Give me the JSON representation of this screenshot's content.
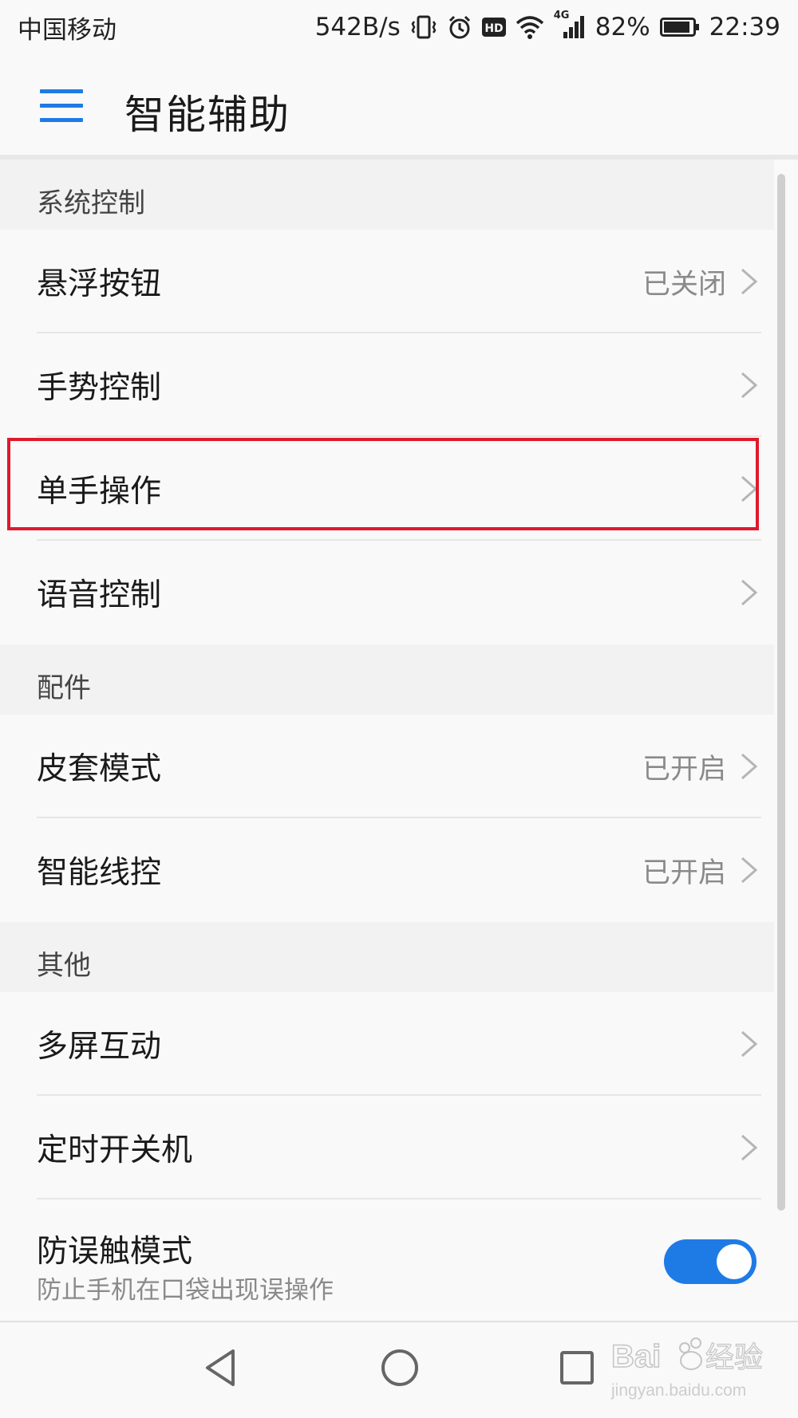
{
  "status_bar": {
    "carrier": "中国移动",
    "speed": "542B/s",
    "network": "4G",
    "battery": "82%",
    "time": "22:39"
  },
  "app_bar": {
    "title": "智能辅助"
  },
  "sections": [
    {
      "header": "系统控制",
      "items": [
        {
          "label": "悬浮按钮",
          "value": "已关闭"
        },
        {
          "label": "手势控制",
          "value": ""
        },
        {
          "label": "单手操作",
          "value": ""
        },
        {
          "label": "语音控制",
          "value": ""
        }
      ]
    },
    {
      "header": "配件",
      "items": [
        {
          "label": "皮套模式",
          "value": "已开启"
        },
        {
          "label": "智能线控",
          "value": "已开启"
        }
      ]
    },
    {
      "header": "其他",
      "items": [
        {
          "label": "多屏互动",
          "value": ""
        },
        {
          "label": "定时开关机",
          "value": ""
        },
        {
          "label": "防误触模式",
          "sublabel": "防止手机在口袋出现误操作",
          "toggle_on": true
        }
      ]
    }
  ],
  "watermark": {
    "brand": "Baidu经验",
    "url": "jingyan.baidu.com"
  },
  "colors": {
    "accent": "#1e7be5",
    "highlight": "#e0192d"
  }
}
